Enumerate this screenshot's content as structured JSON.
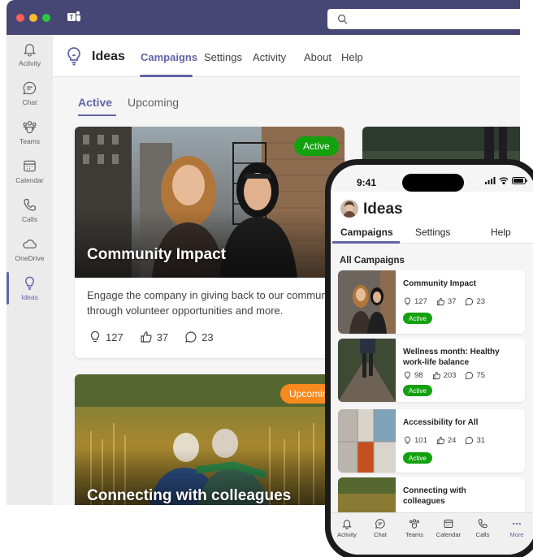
{
  "colors": {
    "brand": "#6264a7",
    "titlebar": "#464775",
    "active_badge": "#13a10e",
    "upcoming_badge": "#f7891f"
  },
  "desktop": {
    "search": {
      "icon": "search-icon"
    },
    "rail": [
      {
        "label": "Activity",
        "icon": "bell-icon"
      },
      {
        "label": "Chat",
        "icon": "chat-icon"
      },
      {
        "label": "Teams",
        "icon": "teams-icon"
      },
      {
        "label": "Calendar",
        "icon": "calendar-icon"
      },
      {
        "label": "Calls",
        "icon": "phone-icon"
      },
      {
        "label": "OneDrive",
        "icon": "cloud-icon"
      },
      {
        "label": "Ideas",
        "icon": "lightbulb-icon",
        "active": true
      }
    ],
    "app": {
      "name": "Ideas",
      "tabs": [
        "Campaigns",
        "Settings",
        "Activity",
        "About",
        "Help"
      ],
      "active_tab": "Campaigns"
    },
    "subtabs": [
      "Active",
      "Upcoming"
    ],
    "cards": [
      {
        "title": "Community Impact",
        "badge": "Active",
        "desc_line1": "Engage the company in giving back to our communit",
        "desc_line2": "through volunteer opportunities and more.",
        "ideas": "127",
        "likes": "37",
        "comments": "23"
      },
      {
        "title": "Connecting with colleagues",
        "badge": "Upcomin"
      }
    ]
  },
  "phone": {
    "time": "9:41",
    "title": "Ideas",
    "tabs": [
      "Campaigns",
      "Settings",
      "Help"
    ],
    "section": "All Campaigns",
    "cards": [
      {
        "title": "Community Impact",
        "ideas": "127",
        "likes": "37",
        "comments": "23",
        "badge": "Active"
      },
      {
        "title_line1": "Wellness month: Healthy",
        "title_line2": "work-life balance",
        "ideas": "98",
        "likes": "203",
        "comments": "75",
        "badge": "Active"
      },
      {
        "title": "Accessibility for All",
        "ideas": "101",
        "likes": "24",
        "comments": "31",
        "badge": "Active"
      },
      {
        "title_line1": "Connecting with",
        "title_line2": "colleagues"
      }
    ],
    "nav": [
      "Activity",
      "Chat",
      "Teams",
      "Calendar",
      "Calls",
      "More"
    ]
  }
}
